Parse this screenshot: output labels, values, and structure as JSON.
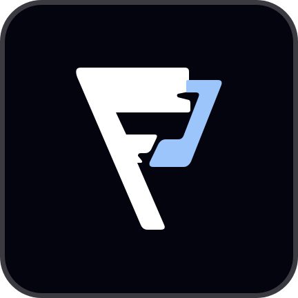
{
  "icon": {
    "name": "app-logo-icon",
    "colors": {
      "background": "#04040f",
      "border": "#3a3a40",
      "letter": "#ffffff",
      "accent": "#9cc5fb"
    }
  }
}
